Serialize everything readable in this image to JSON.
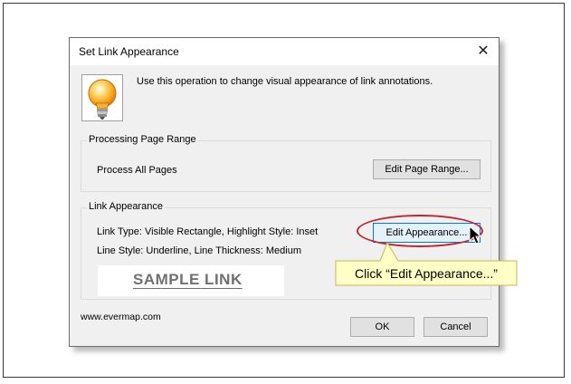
{
  "dialog": {
    "title": "Set Link Appearance",
    "close_glyph": "✕",
    "intro_text": "Use this operation to change visual appearance of link annotations.",
    "icon": "lightbulb-icon"
  },
  "processing_group": {
    "legend": "Processing Page Range",
    "label": "Process All Pages",
    "button": "Edit Page Range..."
  },
  "appearance_group": {
    "legend": "Link Appearance",
    "line1": "Link Type: Visible Rectangle, Highlight Style: Inset",
    "line2": "Line Style: Underline, Line Thickness: Medium",
    "button": "Edit Appearance...",
    "sample_text": "SAMPLE LINK"
  },
  "footer": {
    "website": "www.evermap.com",
    "ok": "OK",
    "cancel": "Cancel"
  },
  "callout": {
    "text": "Click “Edit Appearance...”"
  },
  "colors": {
    "highlight_ellipse": "#c1272d",
    "callout_fill": "#ffffc6",
    "callout_border": "#c9b458",
    "focus_border": "#0078d7"
  }
}
